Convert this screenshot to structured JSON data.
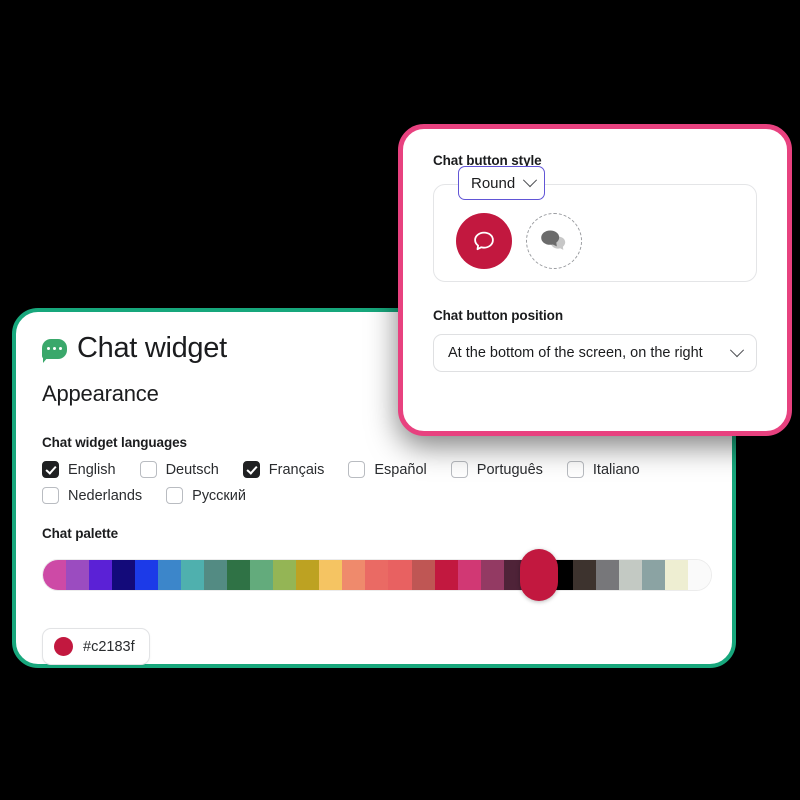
{
  "colors": {
    "green_card_border": "#17a77c",
    "pink_card_border": "#e8417f",
    "select_focus_border": "#6155d6",
    "brand": "#c2183f",
    "title_bubble": "#3aa86b"
  },
  "green_card": {
    "title": "Chat widget",
    "title_icon": "chat-bubble-dots-icon",
    "section_heading": "Appearance",
    "languages": {
      "label": "Chat widget languages",
      "items": [
        {
          "name": "English",
          "checked": true
        },
        {
          "name": "Deutsch",
          "checked": false
        },
        {
          "name": "Français",
          "checked": true
        },
        {
          "name": "Español",
          "checked": false
        },
        {
          "name": "Português",
          "checked": false
        },
        {
          "name": "Italiano",
          "checked": false
        },
        {
          "name": "Nederlands",
          "checked": false
        },
        {
          "name": "Русский",
          "checked": false
        }
      ]
    },
    "palette": {
      "label": "Chat palette",
      "selected_index": 21,
      "swatches": [
        "#cd4aa6",
        "#9b4cc0",
        "#5b21d6",
        "#130a7a",
        "#1c3ae8",
        "#3c86ca",
        "#4fb0ae",
        "#538b83",
        "#2f7245",
        "#63ab7c",
        "#94b555",
        "#bda222",
        "#f5c462",
        "#ef8a6c",
        "#ea6a64",
        "#e86161",
        "#bf5654",
        "#c2183f",
        "#d13874",
        "#933a63",
        "#4f2338",
        "#422f73",
        "#000000",
        "#3d332e",
        "#77777a",
        "#c3c9c3",
        "#8ba3a3",
        "#eeeed2",
        "#fafafa"
      ],
      "selected_value": "#c2183f"
    }
  },
  "pink_card": {
    "style": {
      "label": "Chat button style",
      "select_value": "Round",
      "options": [
        {
          "icon": "speech-bubble-outline-icon",
          "selected": true
        },
        {
          "icon": "two-speech-bubbles-icon",
          "selected": false
        }
      ]
    },
    "position": {
      "label": "Chat button position",
      "select_value": "At the bottom of the screen, on the right"
    }
  }
}
